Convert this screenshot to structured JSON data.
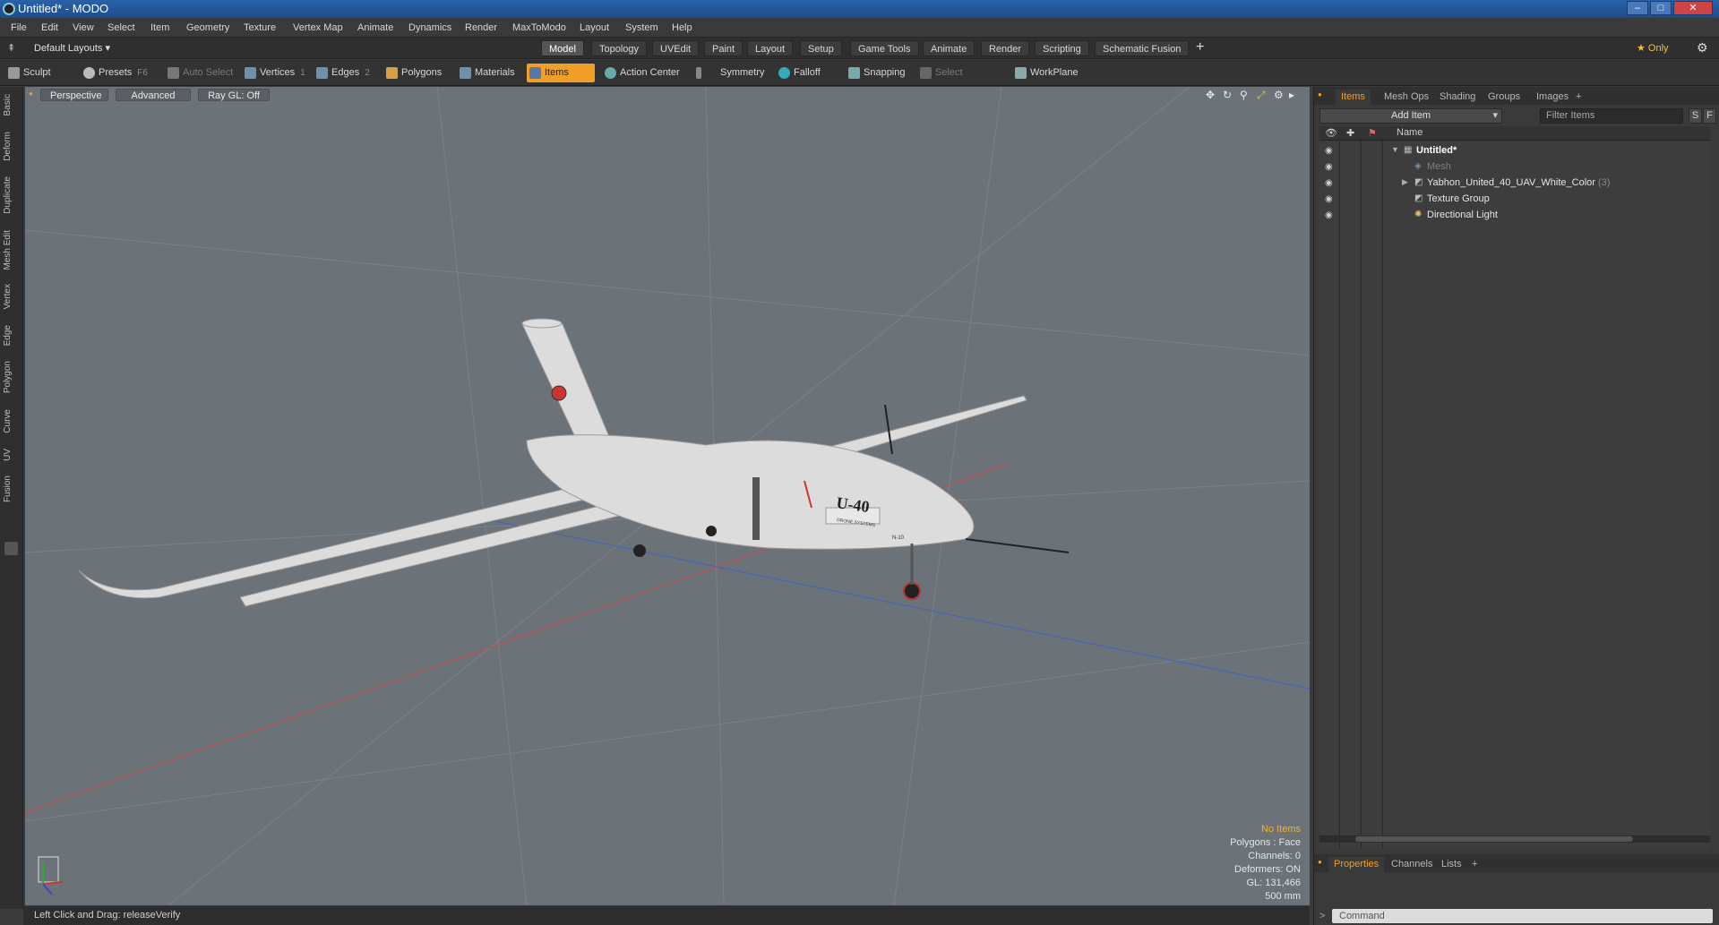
{
  "window": {
    "title": "Untitled* - MODO",
    "btn_min": "–",
    "btn_max": "□",
    "btn_close": "✕"
  },
  "menu": [
    "File",
    "Edit",
    "View",
    "Select",
    "Item",
    "Geometry",
    "Texture",
    "Vertex Map",
    "Animate",
    "Dynamics",
    "Render",
    "MaxToModo",
    "Layout",
    "System",
    "Help"
  ],
  "layouts": {
    "current": "Default Layouts ▾",
    "tabs": [
      "Model",
      "Topology",
      "UVEdit",
      "Paint",
      "Layout",
      "Setup",
      "Game Tools",
      "Animate",
      "Render",
      "Scripting",
      "Schematic Fusion"
    ],
    "active": "Model",
    "add": "+",
    "only": "★ Only",
    "gear": "⚙"
  },
  "toolbar": {
    "sculpt": "Sculpt",
    "presets": "Presets",
    "presets_key": "F6",
    "auto_select": "Auto Select",
    "vertices": "Vertices",
    "vertices_key": "1",
    "edges": "Edges",
    "edges_key": "2",
    "polygons": "Polygons",
    "materials": "Materials",
    "items": "Items",
    "action_center": "Action Center",
    "symmetry": "Symmetry",
    "falloff": "Falloff",
    "snapping": "Snapping",
    "select_through": "Select Through",
    "workplane": "WorkPlane"
  },
  "left_tabs": [
    "Basic",
    "Deform",
    "Duplicate",
    "Mesh Edit",
    "Vertex",
    "Edge",
    "Polygon",
    "Curve",
    "UV",
    "Fusion"
  ],
  "viewport": {
    "view": "Perspective",
    "advanced": "Advanced",
    "raygl": "Ray GL: Off",
    "aircraft_text": "U-40",
    "aircraft_sub": "DRONE SYSTEMS",
    "gear_tag": "N-10",
    "info": {
      "selection": "No Items",
      "polygons": "Polygons : Face",
      "channels": "Channels: 0",
      "deformers": "Deformers: ON",
      "gl": "GL: 131,466",
      "grid": "500 mm"
    }
  },
  "status": {
    "text": "Left Click and Drag:   releaseVerify"
  },
  "panel": {
    "tabs": [
      "Items",
      "Mesh Ops",
      "Shading",
      "Groups",
      "Images"
    ],
    "active": "Items",
    "add_tab": "+",
    "add_item": "Add Item",
    "filter_placeholder": "Filter Items",
    "btn_s": "S",
    "btn_f": "F",
    "col_name": "Name",
    "items": [
      {
        "name": "Untitled*",
        "style": "bold"
      },
      {
        "name": "Mesh",
        "style": "dim"
      },
      {
        "name": "Yabhon_United_40_UAV_White_Color",
        "count": "(3)",
        "style": "normal"
      },
      {
        "name": "Texture Group",
        "style": "normal"
      },
      {
        "name": "Directional Light",
        "style": "normal"
      }
    ],
    "bottom_tabs": [
      "Properties",
      "Channels",
      "Lists"
    ],
    "bottom_active": "Properties",
    "command_placeholder": "Command"
  },
  "colors": {
    "accent": "#f0a028",
    "viewport_bg": "#6b7278",
    "title_blue": "#2a62a8"
  }
}
